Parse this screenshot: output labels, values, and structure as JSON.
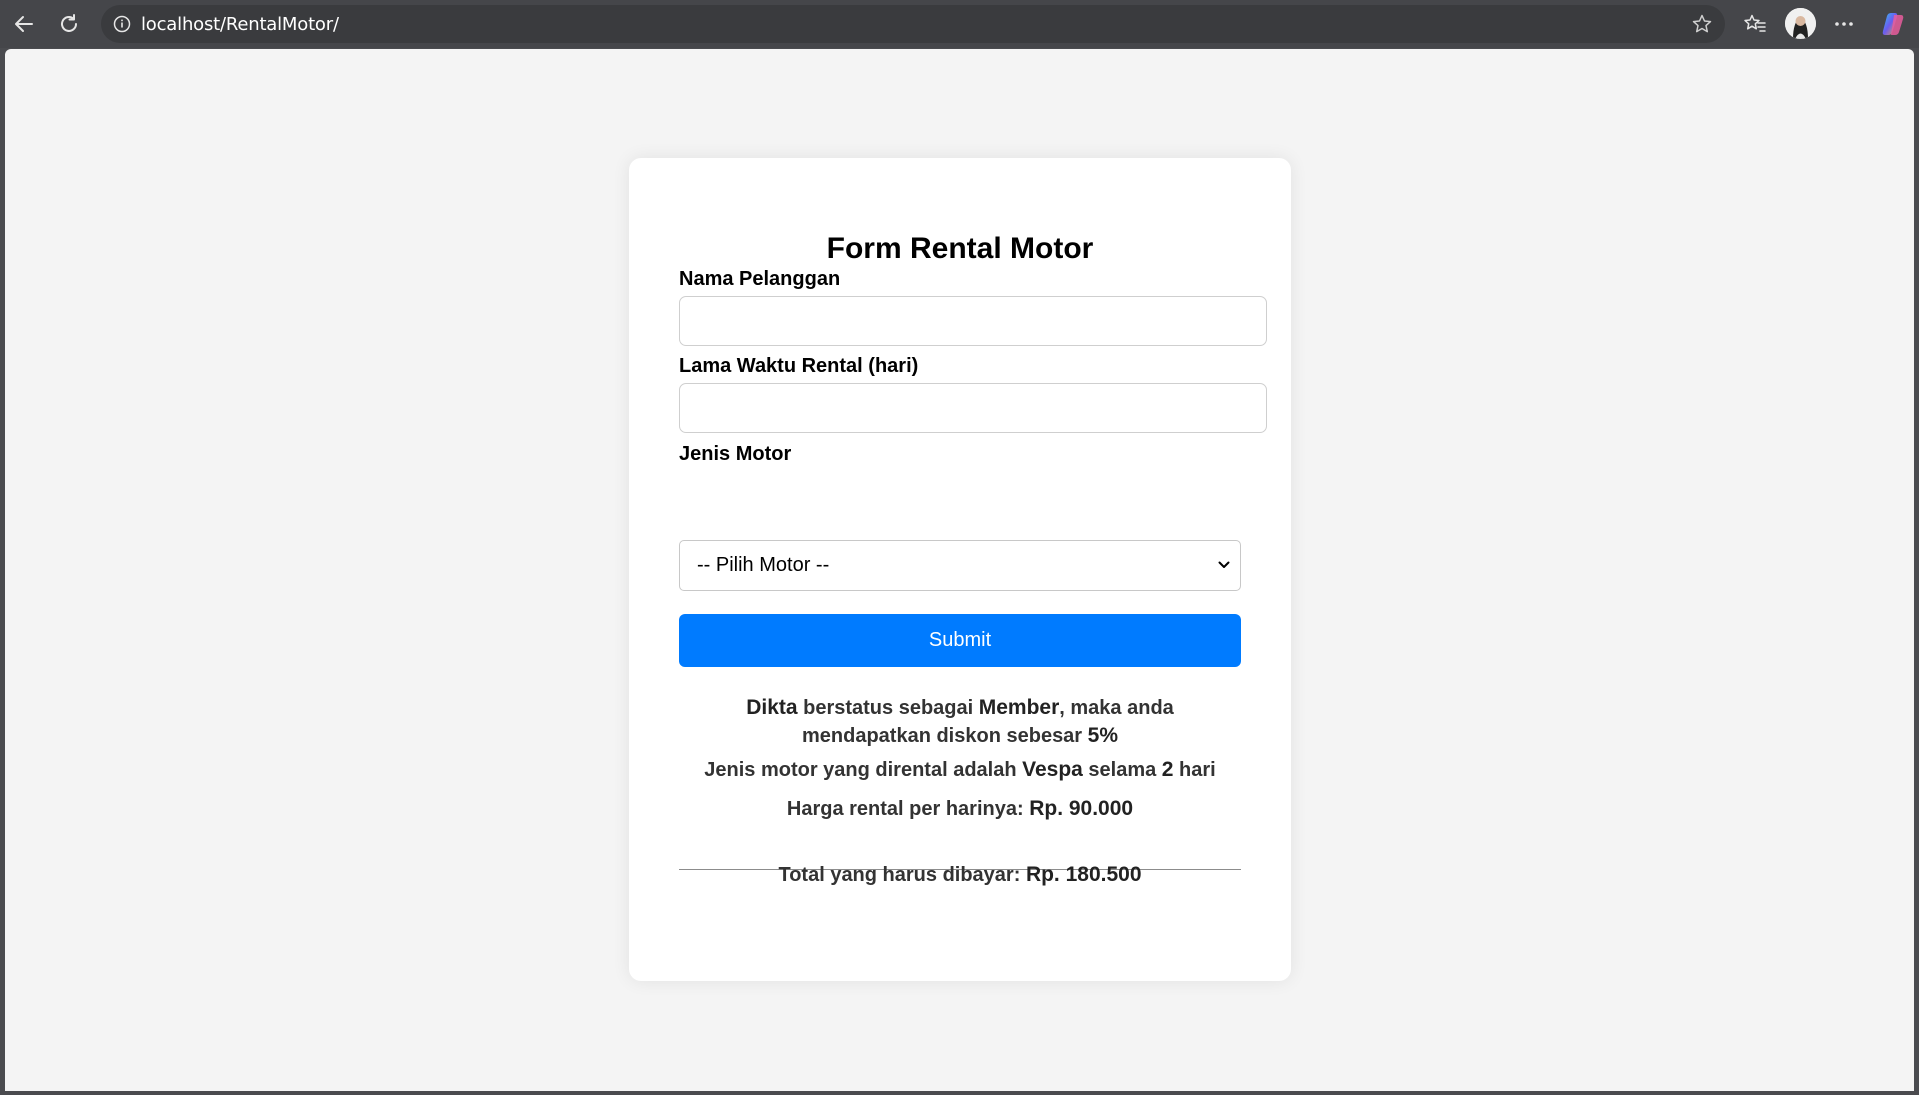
{
  "browser": {
    "url": "localhost/RentalMotor/"
  },
  "colors": {
    "accent": "#007bff",
    "page_background": "#f4f4f4",
    "card_background": "#ffffff",
    "chrome_background": "#45464a"
  },
  "icons": {
    "back": "back-arrow-icon",
    "reload": "reload-icon",
    "info": "info-icon",
    "favorite": "star-icon",
    "favorites_list": "favorites-icon",
    "more": "more-icon",
    "copilot": "copilot-icon",
    "dropdown": "chevron-down-icon"
  },
  "form": {
    "title": "Form Rental Motor",
    "nama_label": "Nama Pelanggan",
    "nama_value": "",
    "lama_label": "Lama Waktu Rental (hari)",
    "lama_value": "",
    "jenis_label": "Jenis Motor",
    "jenis_selected": "-- Pilih Motor --",
    "submit_label": "Submit"
  },
  "result": {
    "line1": {
      "name": "Dikta",
      "text_a": " berstatus sebagai ",
      "status": "Member",
      "text_b": ", maka anda mendapatkan diskon sebesar ",
      "discount": "5%"
    },
    "line2": {
      "text_a": "Jenis motor yang dirental adalah ",
      "motor": "Vespa",
      "text_b": " selama ",
      "days": "2",
      "text_c": " hari"
    },
    "line3": {
      "text_a": "Harga rental per harinya: ",
      "price": "Rp. 90.000"
    },
    "total": {
      "text_a": "Total yang harus dibayar: ",
      "amount": "Rp. 180.500"
    }
  }
}
